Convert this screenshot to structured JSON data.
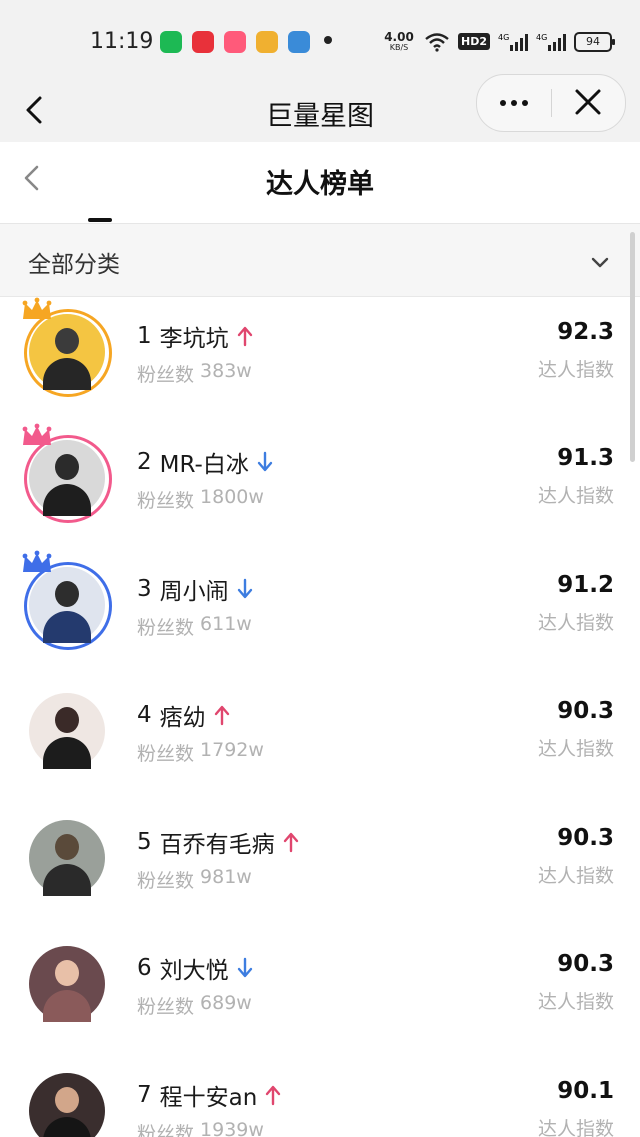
{
  "status_bar": {
    "time": "11:19",
    "net_speed_value": "4.00",
    "net_speed_unit": "KB/S",
    "hd_badge": "HD2",
    "signal_1": "4G",
    "signal_2": "4G",
    "battery": "94",
    "app_icon_colors": [
      "#1db954",
      "#e8313a",
      "#ff5a7a",
      "#f0b030",
      "#3a8bd8"
    ]
  },
  "nav": {
    "title": "巨量星图",
    "back_icon": "chevron-left-icon",
    "more_icon": "more-dots-icon",
    "close_icon": "close-icon"
  },
  "page": {
    "title": "达人榜单",
    "back_icon": "chevron-left-icon"
  },
  "filter": {
    "label": "全部分类",
    "chevron_icon": "chevron-down-icon"
  },
  "colors": {
    "trend_up": "#e0466e",
    "trend_down": "#3d7de0",
    "crown_1": "#f6a623",
    "crown_2": "#f25a8c",
    "crown_3": "#3f6ee8"
  },
  "list": {
    "fans_label": "粉丝数",
    "score_label": "达人指数",
    "items": [
      {
        "rank": "1",
        "name": "李坑坑",
        "trend": "up",
        "fans": "383w",
        "score": "92.3"
      },
      {
        "rank": "2",
        "name": "MR-白冰",
        "trend": "down",
        "fans": "1800w",
        "score": "91.3"
      },
      {
        "rank": "3",
        "name": "周小闹",
        "trend": "down",
        "fans": "611w",
        "score": "91.2"
      },
      {
        "rank": "4",
        "name": "痞幼",
        "trend": "up",
        "fans": "1792w",
        "score": "90.3"
      },
      {
        "rank": "5",
        "name": "百乔有毛病",
        "trend": "up",
        "fans": "981w",
        "score": "90.3"
      },
      {
        "rank": "6",
        "name": "刘大悦",
        "trend": "down",
        "fans": "689w",
        "score": "90.3"
      },
      {
        "rank": "7",
        "name": "程十安an",
        "trend": "up",
        "fans": "1939w",
        "score": "90.1"
      }
    ]
  }
}
